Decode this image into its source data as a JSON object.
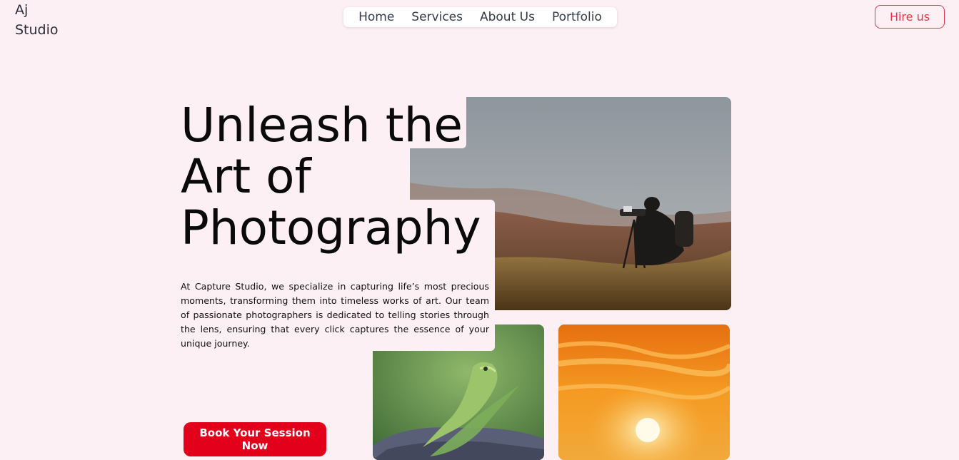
{
  "brand": {
    "line1": "Aj",
    "line2": "Studio"
  },
  "nav": {
    "items": [
      {
        "label": "Home"
      },
      {
        "label": "Services"
      },
      {
        "label": "About Us"
      },
      {
        "label": "Portfolio"
      }
    ]
  },
  "header": {
    "hire_label": "Hire us"
  },
  "hero": {
    "headline_lines": [
      "Unleash the",
      "Art of",
      "Photography"
    ],
    "description": "At Capture Studio, we specialize in capturing life’s most precious moments, transforming them into timeless works of art. Our team of passionate photographers is dedicated to telling stories through the lens, ensuring that every click captures the essence of your unique journey.",
    "cta_label": "Book Your Session Now"
  },
  "images": [
    {
      "subject": "photographer-on-hill"
    },
    {
      "subject": "green-lizard-on-rock"
    },
    {
      "subject": "orange-sunset-sky"
    }
  ],
  "colors": {
    "background": "#fdf0f5",
    "accent": "#e3001b",
    "hire_border": "#e03a4a"
  }
}
